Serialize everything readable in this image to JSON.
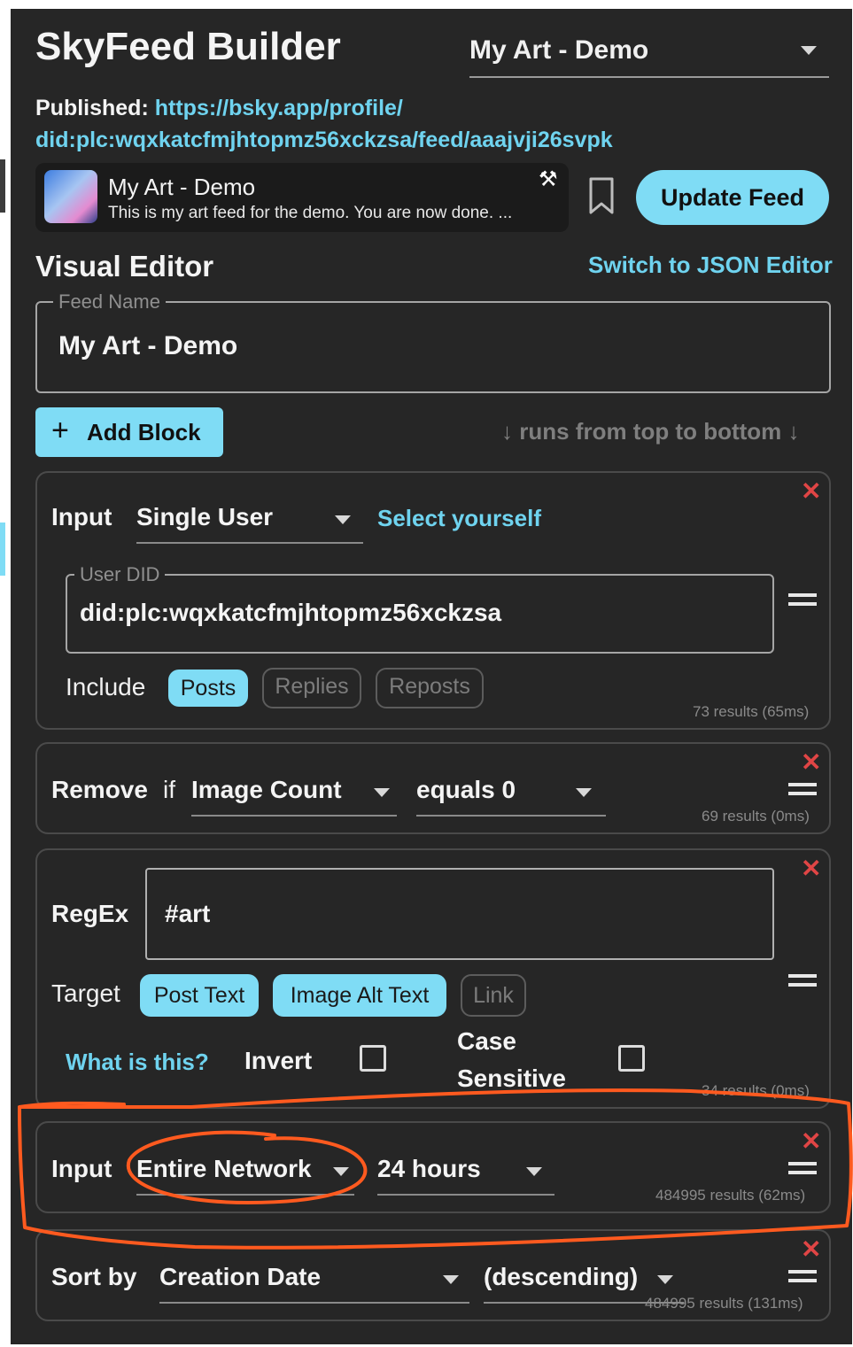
{
  "header": {
    "title": "SkyFeed Builder",
    "feed_select_value": "My Art - Demo"
  },
  "published": {
    "label": "Published:",
    "url_line1": "https://bsky.app/profile/",
    "url_line2": "did:plc:wqxkatcfmjhtopmz56xckzsa/feed/aaajvji26svpk"
  },
  "feed_card": {
    "name": "My Art - Demo",
    "description": "This is my art feed for the demo. You are now done. ...",
    "tool_icon": "tools-icon"
  },
  "actions": {
    "update_label": "Update Feed"
  },
  "editor": {
    "title": "Visual Editor",
    "switch_label": "Switch to JSON Editor",
    "feed_name_legend": "Feed Name",
    "feed_name_value": "My Art - Demo",
    "add_block_label": "Add Block",
    "run_hint": "↓ runs from top to bottom ↓"
  },
  "blocks": [
    {
      "label": "Input",
      "select": "Single User",
      "link": "Select yourself",
      "did_legend": "User DID",
      "did_value": "did:plc:wqxkatcfmjhtopmz56xckzsa",
      "include_label": "Include",
      "chips": [
        {
          "label": "Posts",
          "active": true
        },
        {
          "label": "Replies",
          "active": false
        },
        {
          "label": "Reposts",
          "active": false
        }
      ],
      "results": "73 results (65ms)"
    },
    {
      "label": "Remove",
      "if_word": "if",
      "field_select": "Image Count",
      "op_select": "equals 0",
      "results": "69 results (0ms)"
    },
    {
      "label": "RegEx",
      "value": "#art",
      "target_label": "Target",
      "chips": [
        {
          "label": "Post Text",
          "active": true
        },
        {
          "label": "Image Alt Text",
          "active": true
        },
        {
          "label": "Link",
          "active": false
        }
      ],
      "help_link": "What is this?",
      "invert_label": "Invert",
      "case_label_1": "Case",
      "case_label_2": "Sensitive",
      "invert_checked": false,
      "case_checked": false,
      "results": "34 results (0ms)"
    },
    {
      "label": "Input",
      "select": "Entire Network",
      "range_select": "24 hours",
      "results": "484995 results (62ms)"
    },
    {
      "label": "Sort by",
      "select": "Creation Date",
      "order_select": "(descending)",
      "results": "484995 results (131ms)"
    }
  ],
  "annotation_color": "#ff5a1f",
  "accent_color": "#7fdcf5"
}
